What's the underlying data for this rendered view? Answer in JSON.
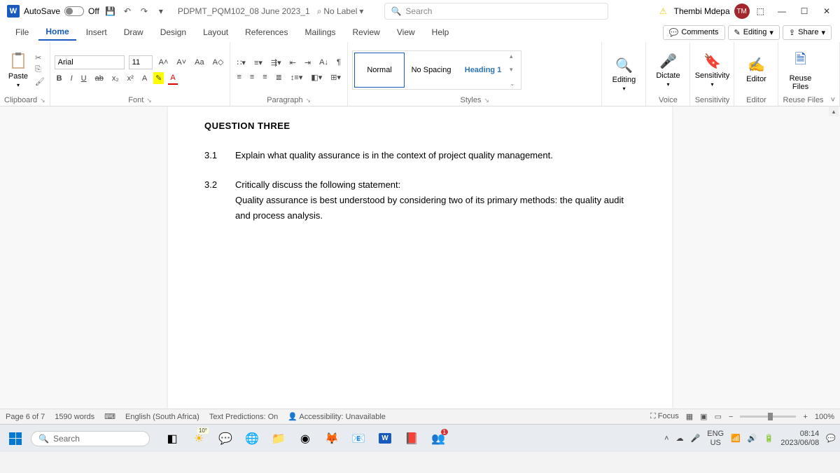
{
  "titlebar": {
    "app_letter": "W",
    "autosave_label": "AutoSave",
    "autosave_state": "Off",
    "doc_name": "PDPMT_PQM102_08 June 2023_1",
    "sensitivity_label": "No Label",
    "search_placeholder": "Search",
    "user_name": "Thembi Mdepa",
    "user_initials": "TM"
  },
  "tabs": {
    "file": "File",
    "home": "Home",
    "insert": "Insert",
    "draw": "Draw",
    "design": "Design",
    "layout": "Layout",
    "references": "References",
    "mailings": "Mailings",
    "review": "Review",
    "view": "View",
    "help": "Help",
    "comments": "Comments",
    "editing": "Editing",
    "share": "Share"
  },
  "ribbon": {
    "clipboard": {
      "paste": "Paste",
      "label": "Clipboard"
    },
    "font": {
      "name": "Arial",
      "size": "11",
      "label": "Font",
      "bold": "B",
      "italic": "I",
      "underline": "U",
      "strike": "ab",
      "sub": "x₂",
      "sup": "x²",
      "case": "Aa",
      "grow": "A˄",
      "shrink": "A˅",
      "effects": "A",
      "highlight": "✎",
      "color": "A"
    },
    "paragraph": {
      "label": "Paragraph"
    },
    "styles": {
      "label": "Styles",
      "items": [
        "Normal",
        "No Spacing",
        "Heading 1"
      ]
    },
    "editing": "Editing",
    "voice": {
      "btn": "Dictate",
      "label": "Voice"
    },
    "sensitivity": {
      "btn": "Sensitivity",
      "label": "Sensitivity"
    },
    "editor": {
      "btn": "Editor",
      "label": "Editor"
    },
    "reuse": {
      "btn": "Reuse Files",
      "label": "Reuse Files"
    }
  },
  "document": {
    "heading": "QUESTION THREE",
    "q1_num": "3.1",
    "q1_text": "Explain what quality assurance is in the context of project quality management.",
    "q2_num": "3.2",
    "q2_line1": "Critically discuss the following statement:",
    "q2_line2": "Quality assurance is best understood by considering two of its primary methods: the quality audit and process analysis."
  },
  "statusbar": {
    "page": "Page 6 of 7",
    "words": "1590 words",
    "lang": "English (South Africa)",
    "predictions": "Text Predictions: On",
    "accessibility": "Accessibility: Unavailable",
    "focus": "Focus",
    "zoom": "100%"
  },
  "taskbar": {
    "search": "Search",
    "temp": "10°",
    "lang1": "ENG",
    "lang2": "US",
    "time": "08:14",
    "date": "2023/06/08",
    "notif_count": "1"
  }
}
